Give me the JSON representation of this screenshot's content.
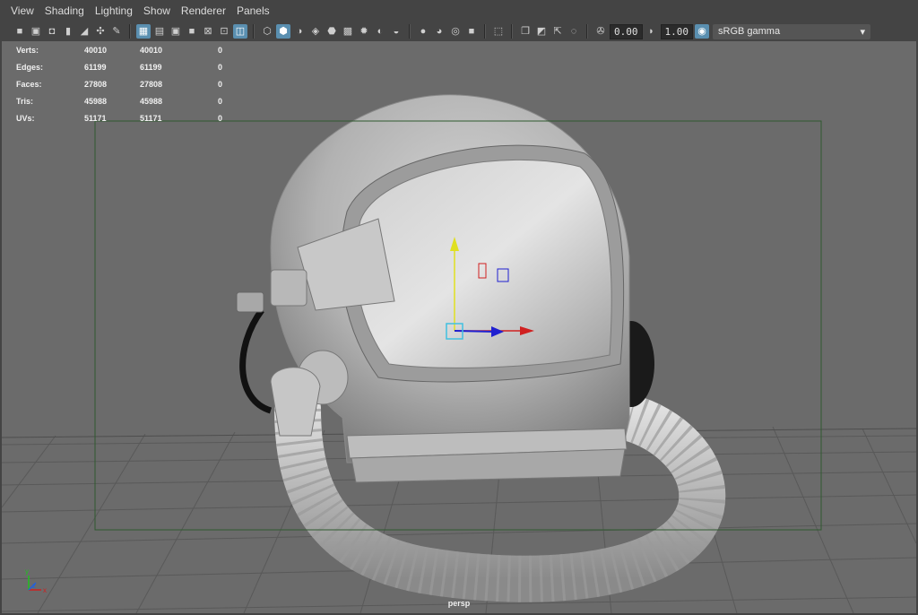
{
  "menubar": {
    "items": [
      {
        "label": "View"
      },
      {
        "label": "Shading"
      },
      {
        "label": "Lighting"
      },
      {
        "label": "Show"
      },
      {
        "label": "Renderer"
      },
      {
        "label": "Panels"
      }
    ]
  },
  "toolbar": {
    "exposure_value": "0.00",
    "gamma_value": "1.00",
    "color_management": "sRGB gamma"
  },
  "hud": {
    "rows": [
      {
        "label": "Verts:",
        "v1": "40010",
        "v2": "40010",
        "v3": "0"
      },
      {
        "label": "Edges:",
        "v1": "61199",
        "v2": "61199",
        "v3": "0"
      },
      {
        "label": "Faces:",
        "v1": "27808",
        "v2": "27808",
        "v3": "0"
      },
      {
        "label": "Tris:",
        "v1": "45988",
        "v2": "45988",
        "v3": "0"
      },
      {
        "label": "UVs:",
        "v1": "51171",
        "v2": "51171",
        "v3": "0"
      }
    ]
  },
  "viewport": {
    "camera_label": "persp",
    "axis": {
      "x": "x",
      "y": "y",
      "z": "z"
    }
  },
  "colors": {
    "viewport_bg": "#6b6b6b",
    "grid": "#5a5a5a",
    "resolution_gate": "#2f5a2f",
    "manip_x": "#d02020",
    "manip_y": "#e0e020",
    "manip_z": "#2020d0",
    "active_icon": "#5a8fb0"
  }
}
